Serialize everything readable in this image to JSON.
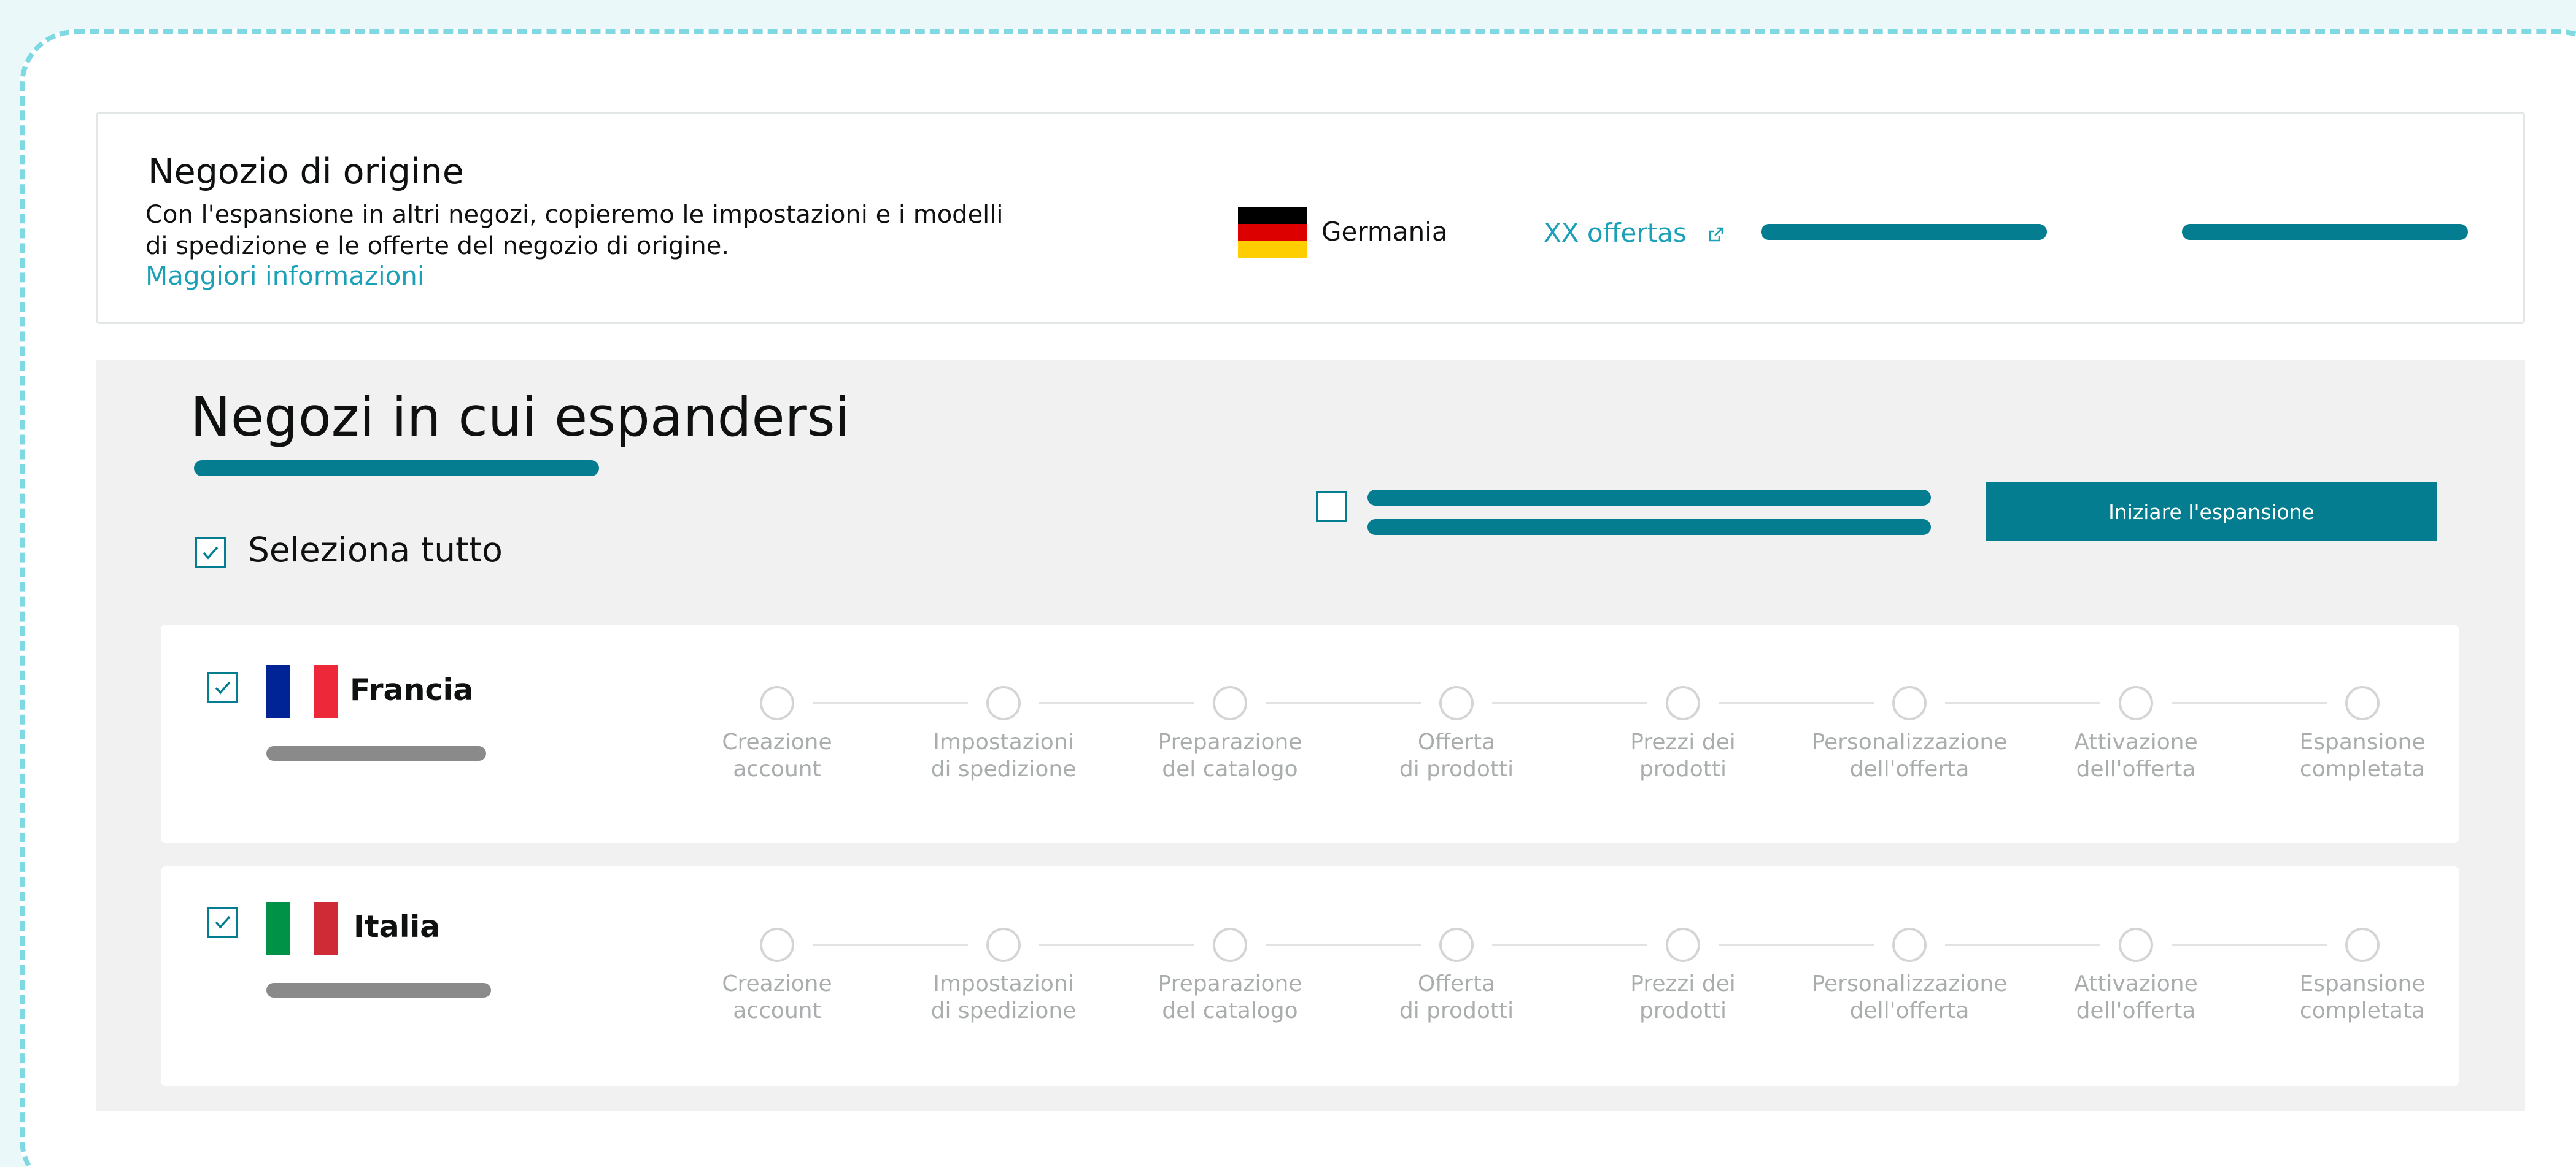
{
  "origin": {
    "title": "Negozio di origine",
    "description": "Con l'espansione in altri negozi, copieremo le impostazioni e i modelli di spedizione e le offerte del negozio di origine.",
    "learn_more": "Maggiori informazioni",
    "country": "Germania",
    "flag_colors": [
      "#000000",
      "#dd0000",
      "#ffce00"
    ],
    "offers_link": "XX offertas",
    "offers_icon": "external-link-icon"
  },
  "expansion": {
    "title": "Negozi in cui espandersi",
    "select_all_label": "Seleziona tutto",
    "select_all_checked": true,
    "option_checked": false,
    "start_button": "Iniziare l'espansione",
    "accent_color": "#037d8f"
  },
  "steps": [
    "Creazione\naccount",
    "Impostazioni\ndi spedizione",
    "Preparazione\ndel catalogo",
    "Offerta\ndi prodotti",
    "Prezzi dei\nprodotti",
    "Personalizzazione\ndell'offerta",
    "Attivazione\ndell'offerta",
    "Espansione\ncompletata"
  ],
  "countries": [
    {
      "name": "Francia",
      "checked": true,
      "flag_colors": [
        "#002395",
        "#ffffff",
        "#ed2939"
      ]
    },
    {
      "name": "Italia",
      "checked": true,
      "flag_colors": [
        "#009246",
        "#ffffff",
        "#ce2b37"
      ]
    }
  ]
}
